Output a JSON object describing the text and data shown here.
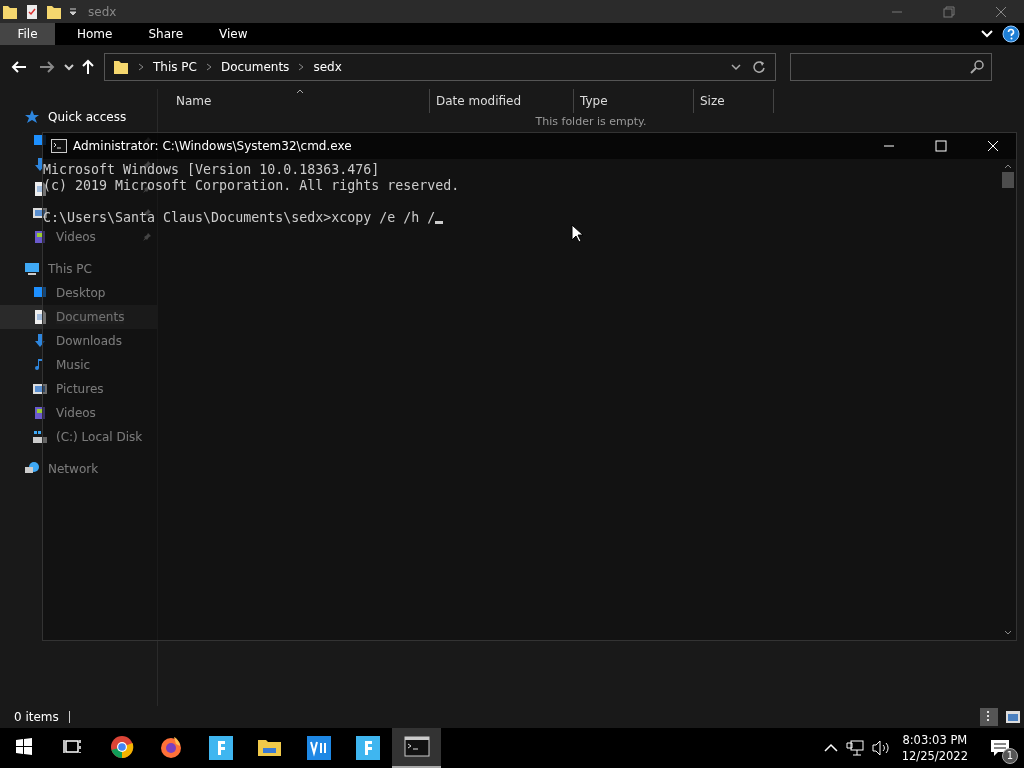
{
  "explorer": {
    "title": "sedx",
    "ribbon_tabs": [
      {
        "label": "File",
        "selected": true
      },
      {
        "label": "Home",
        "selected": false
      },
      {
        "label": "Share",
        "selected": false
      },
      {
        "label": "View",
        "selected": false
      }
    ],
    "address": {
      "segments": [
        "This PC",
        "Documents",
        "sedx"
      ]
    },
    "sidebar": [
      {
        "label": "Quick access",
        "kind": "star",
        "selected": false,
        "children": [
          {
            "kind": "desktop",
            "pinned": true,
            "selected": false
          },
          {
            "kind": "downloads",
            "pinned": true,
            "selected": false
          },
          {
            "kind": "documents",
            "pinned": true,
            "selected": false
          },
          {
            "kind": "pictures",
            "pinned": true,
            "selected": false
          },
          {
            "label": "Videos",
            "kind": "videos",
            "pinned": true,
            "selected": false
          }
        ]
      },
      {
        "label": "This PC",
        "kind": "pc",
        "selected": false,
        "children": [
          {
            "label": "Desktop",
            "kind": "desktop",
            "selected": false
          },
          {
            "label": "Documents",
            "kind": "documents",
            "selected": true
          },
          {
            "label": "Downloads",
            "kind": "downloads",
            "selected": false
          },
          {
            "label": "Music",
            "kind": "music",
            "selected": false
          },
          {
            "label": "Pictures",
            "kind": "pictures",
            "selected": false
          },
          {
            "label": "Videos",
            "kind": "videos",
            "selected": false
          },
          {
            "label": "(C:) Local Disk",
            "kind": "disk",
            "selected": false
          }
        ]
      },
      {
        "label": "Network",
        "kind": "network",
        "selected": false
      }
    ],
    "columns": [
      "Name",
      "Date modified",
      "Type",
      "Size"
    ],
    "empty_message": "This folder is empty.",
    "status": "0 items"
  },
  "cmd": {
    "title": "Administrator: C:\\Windows\\System32\\cmd.exe",
    "lines": [
      "Microsoft Windows [Version 10.0.18363.476]",
      "(c) 2019 Microsoft Corporation. All rights reserved."
    ],
    "prompt": "C:\\Users\\Santa Claus\\Documents\\sedx>xcopy /e /h /"
  },
  "taskbar": {
    "items": [
      {
        "kind": "start",
        "active": false
      },
      {
        "kind": "taskview",
        "active": false
      },
      {
        "kind": "chrome",
        "active": false
      },
      {
        "kind": "firefox",
        "active": false
      },
      {
        "kind": "f-app",
        "active": false
      },
      {
        "kind": "explorer",
        "active": false
      },
      {
        "kind": "vs",
        "active": false
      },
      {
        "kind": "f-app",
        "active": false
      },
      {
        "kind": "cmd",
        "active": true
      }
    ],
    "time": "8:03:03 PM",
    "date": "12/25/2022",
    "notifications": "1"
  }
}
